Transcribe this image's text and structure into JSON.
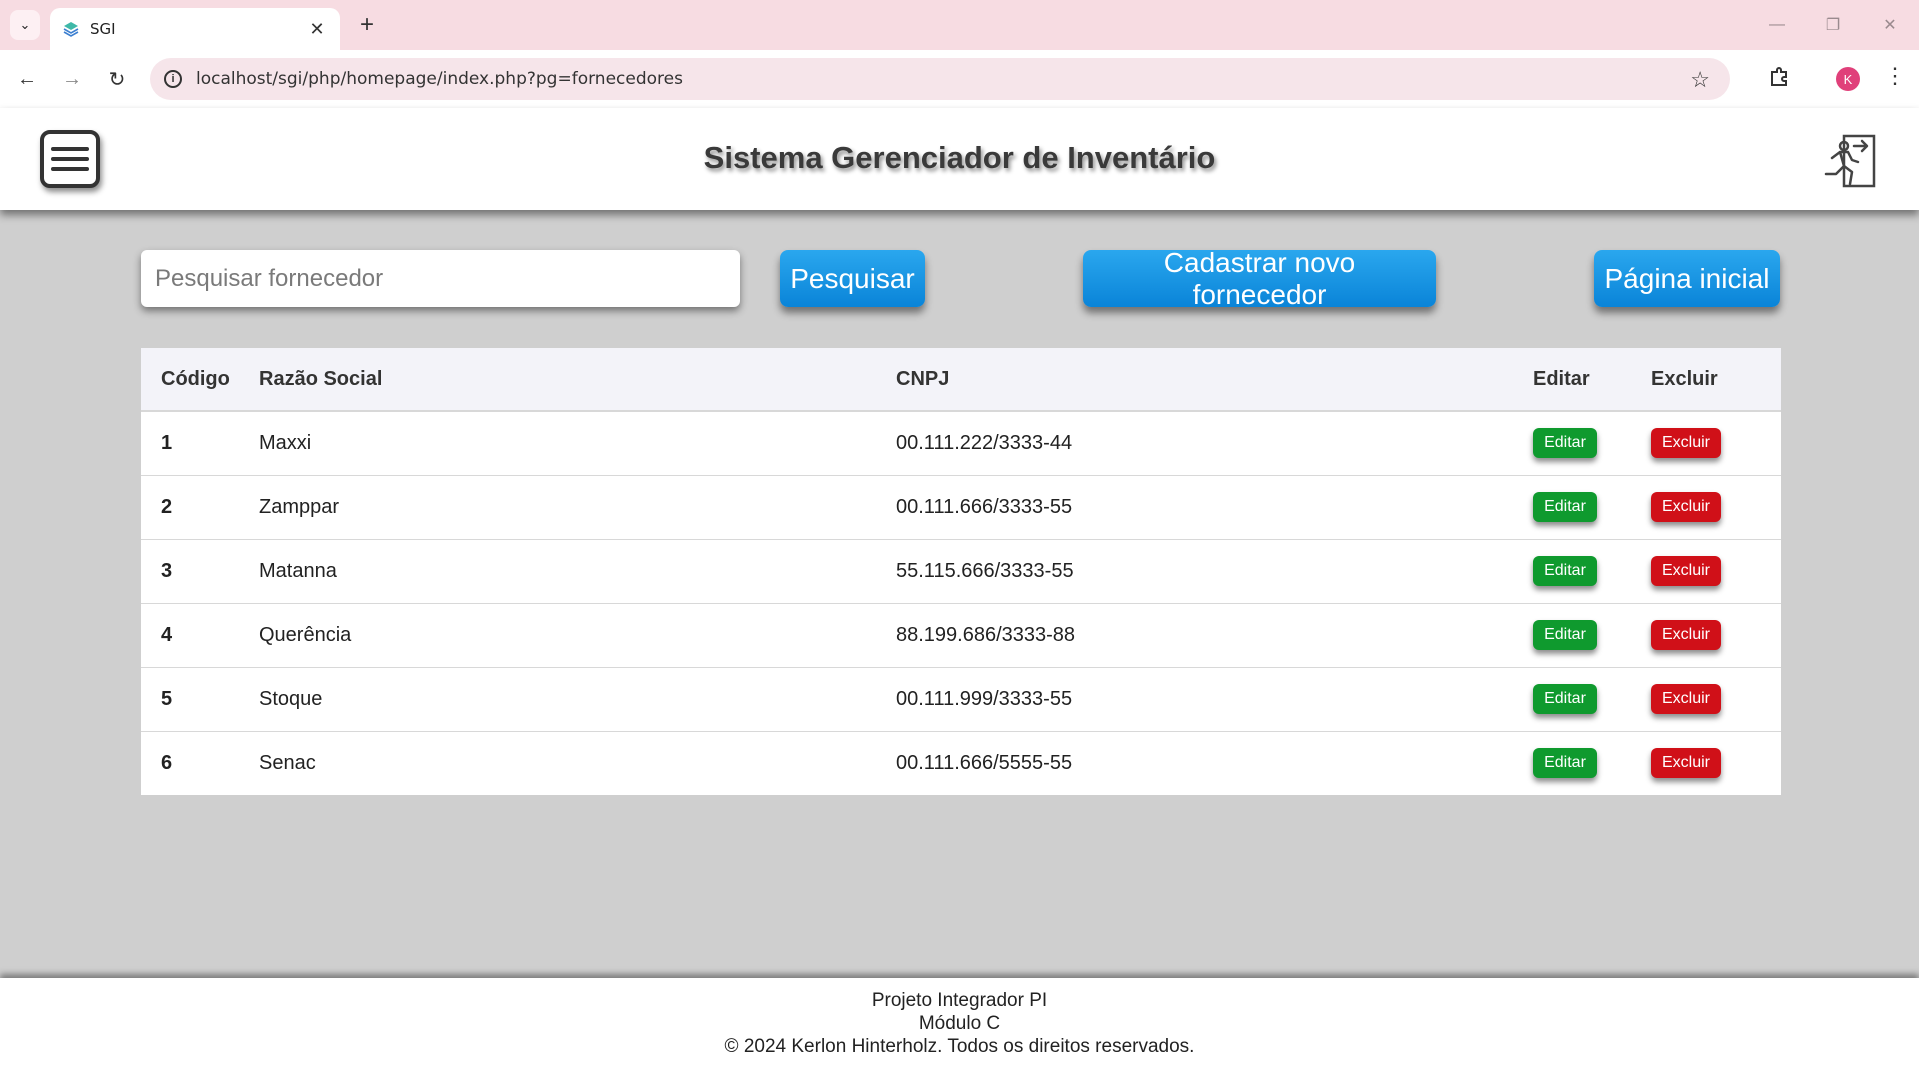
{
  "browser": {
    "tab_title": "SGI",
    "url": "localhost/sgi/php/homepage/index.php?pg=fornecedores",
    "profile_initial": "K"
  },
  "header": {
    "title": "Sistema Gerenciador de Inventário"
  },
  "search": {
    "placeholder": "Pesquisar fornecedor",
    "value": "",
    "search_label": "Pesquisar",
    "new_label": "Cadastrar novo fornecedor",
    "home_label": "Página inicial"
  },
  "table": {
    "headers": {
      "code": "Código",
      "razao": "Razão Social",
      "cnpj": "CNPJ",
      "edit": "Editar",
      "delete": "Excluir"
    },
    "rows": [
      {
        "code": "1",
        "razao": "Maxxi",
        "cnpj": "00.111.222/3333-44",
        "edit": "Editar",
        "delete": "Excluir"
      },
      {
        "code": "2",
        "razao": "Zamppar",
        "cnpj": "00.111.666/3333-55",
        "edit": "Editar",
        "delete": "Excluir"
      },
      {
        "code": "3",
        "razao": "Matanna",
        "cnpj": "55.115.666/3333-55",
        "edit": "Editar",
        "delete": "Excluir"
      },
      {
        "code": "4",
        "razao": "Querência",
        "cnpj": "88.199.686/3333-88",
        "edit": "Editar",
        "delete": "Excluir"
      },
      {
        "code": "5",
        "razao": "Stoque",
        "cnpj": "00.111.999/3333-55",
        "edit": "Editar",
        "delete": "Excluir"
      },
      {
        "code": "6",
        "razao": "Senac",
        "cnpj": "00.111.666/5555-55",
        "edit": "Editar",
        "delete": "Excluir"
      }
    ]
  },
  "footer": {
    "line1": "Projeto Integrador PI",
    "line2": "Módulo C",
    "line3": "© 2024 Kerlon Hinterholz. Todos os direitos reservados."
  },
  "colors": {
    "accent_blue": "#0a84d8",
    "edit_green": "#0f9a2e",
    "delete_red": "#d01018",
    "page_bg": "#cfcfcf"
  }
}
